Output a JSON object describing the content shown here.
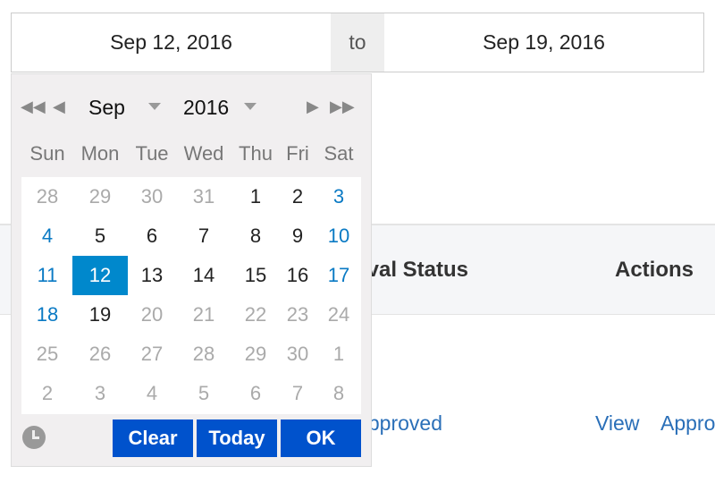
{
  "range": {
    "start": "Sep 12, 2016",
    "separator": "to",
    "end": "Sep 19, 2016"
  },
  "table": {
    "headers": [
      "Approval Status",
      "Actions"
    ],
    "row": {
      "status": "Approved",
      "actions": [
        "View",
        "Approve"
      ]
    }
  },
  "calendar": {
    "month": "Sep",
    "year": "2016",
    "nav_icons": [
      "double-left-icon",
      "left-icon",
      "right-icon",
      "double-right-icon"
    ],
    "weekdays": [
      "Sun",
      "Mon",
      "Tue",
      "Wed",
      "Thu",
      "Fri",
      "Sat"
    ],
    "weeks": [
      [
        "28",
        "29",
        "30",
        "31",
        "1",
        "2",
        "3"
      ],
      [
        "4",
        "5",
        "6",
        "7",
        "8",
        "9",
        "10"
      ],
      [
        "11",
        "12",
        "13",
        "14",
        "15",
        "16",
        "17"
      ],
      [
        "18",
        "19",
        "20",
        "21",
        "22",
        "23",
        "24"
      ],
      [
        "25",
        "26",
        "27",
        "28",
        "29",
        "30",
        "1"
      ],
      [
        "2",
        "3",
        "4",
        "5",
        "6",
        "7",
        "8"
      ]
    ],
    "selected": "12",
    "buttons": {
      "clear": "Clear",
      "today": "Today",
      "ok": "OK"
    },
    "colors": {
      "selected": "#0088cc",
      "button": "#0052cc",
      "weekend": "#0a7ac4"
    }
  }
}
